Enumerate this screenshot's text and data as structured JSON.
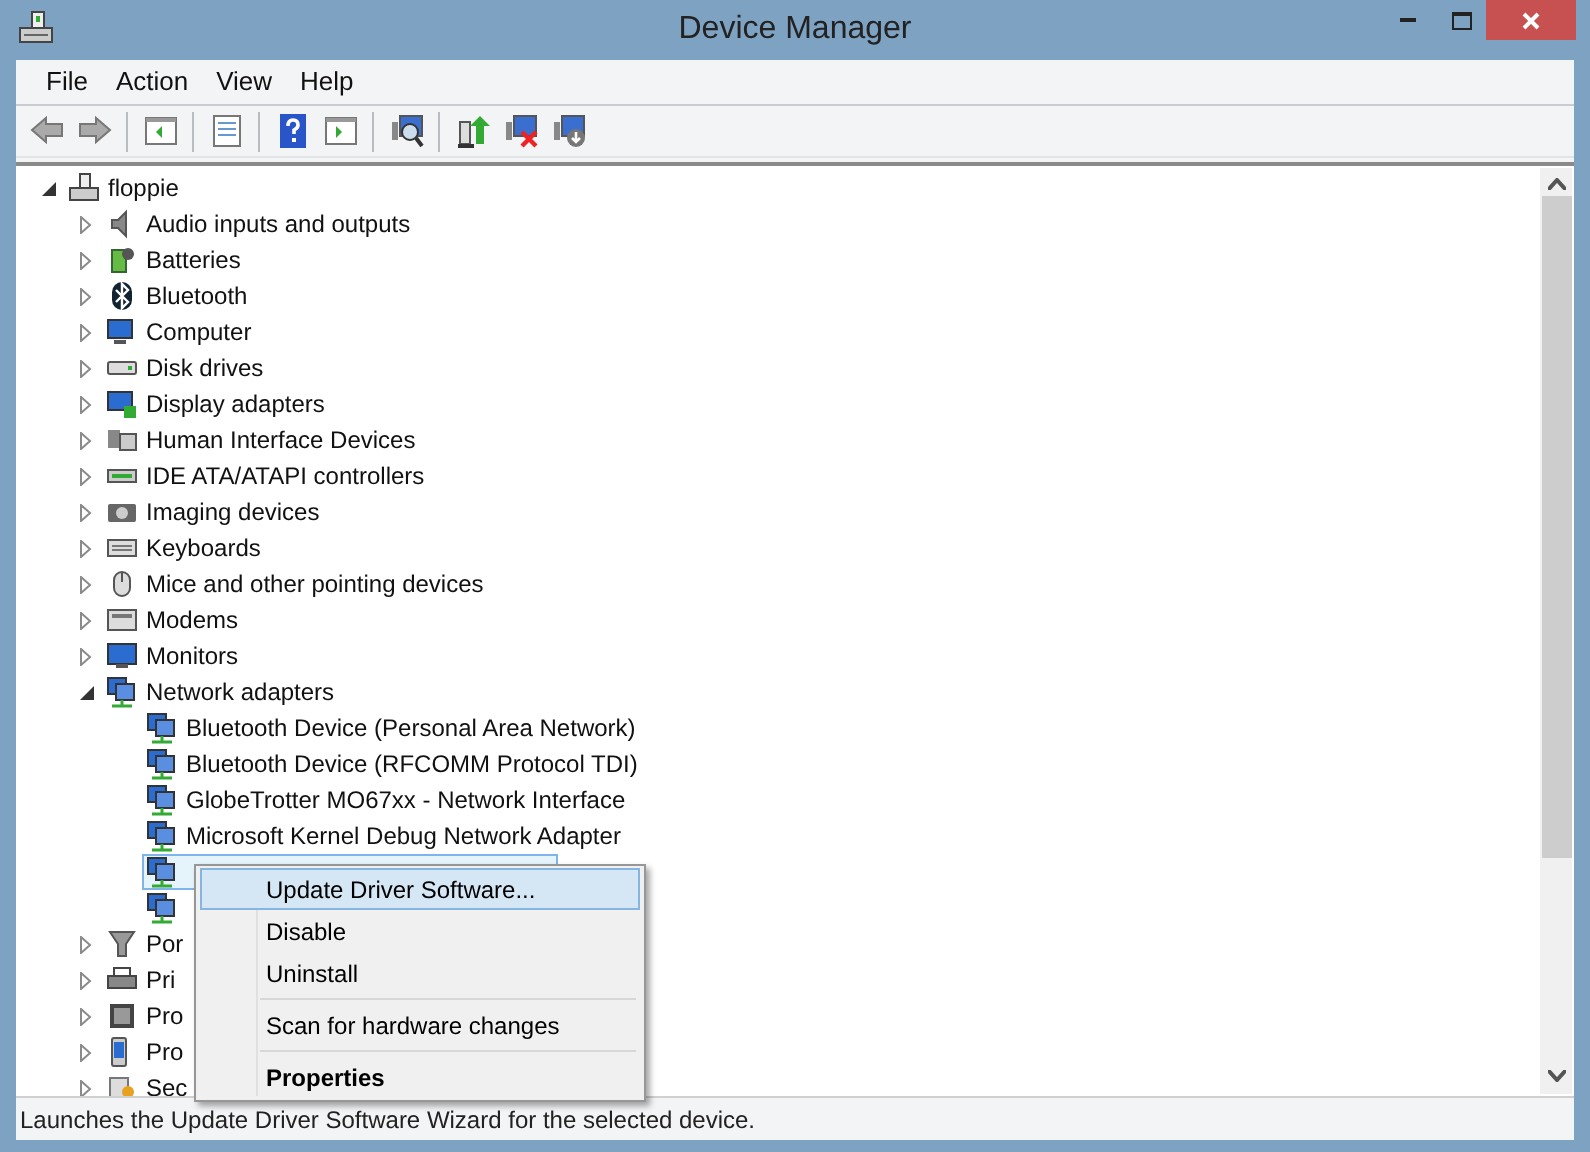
{
  "window": {
    "title": "Device Manager"
  },
  "menu_bar": [
    {
      "label": "File"
    },
    {
      "label": "Action"
    },
    {
      "label": "View"
    },
    {
      "label": "Help"
    }
  ],
  "tree": {
    "label": "floppie",
    "expanded": true,
    "children": [
      {
        "label": "Audio inputs and outputs",
        "expanded": false
      },
      {
        "label": "Batteries",
        "expanded": false
      },
      {
        "label": "Bluetooth",
        "expanded": false
      },
      {
        "label": "Computer",
        "expanded": false
      },
      {
        "label": "Disk drives",
        "expanded": false
      },
      {
        "label": "Display adapters",
        "expanded": false
      },
      {
        "label": "Human Interface Devices",
        "expanded": false
      },
      {
        "label": "IDE ATA/ATAPI controllers",
        "expanded": false
      },
      {
        "label": "Imaging devices",
        "expanded": false
      },
      {
        "label": "Keyboards",
        "expanded": false
      },
      {
        "label": "Mice and other pointing devices",
        "expanded": false
      },
      {
        "label": "Modems",
        "expanded": false
      },
      {
        "label": "Monitors",
        "expanded": false
      },
      {
        "label": "Network adapters",
        "expanded": true,
        "children": [
          {
            "label": "Bluetooth Device (Personal Area Network)",
            "selected": false
          },
          {
            "label": "Bluetooth Device (RFCOMM Protocol TDI)",
            "selected": false
          },
          {
            "label": "GlobeTrotter MO67xx - Network Interface",
            "selected": false
          },
          {
            "label": "Microsoft Kernel Debug Network Adapter",
            "selected": false
          },
          {
            "selected": true
          },
          {
            "selected": false
          }
        ]
      },
      {
        "label": "Por",
        "expanded": false
      },
      {
        "label": "Pri",
        "expanded": false
      },
      {
        "label": "Pro",
        "expanded": false
      },
      {
        "label": "Pro",
        "expanded": false
      },
      {
        "label": "Sec",
        "expanded": false
      }
    ]
  },
  "context_menu": [
    {
      "kind": "command",
      "label": "Update Driver Software...",
      "selected": true
    },
    {
      "kind": "command",
      "label": "Disable",
      "selected": false
    },
    {
      "kind": "command",
      "label": "Uninstall",
      "selected": false
    },
    {
      "kind": "separator"
    },
    {
      "kind": "command",
      "label": "Scan for hardware changes",
      "selected": false
    },
    {
      "kind": "separator"
    },
    {
      "kind": "command",
      "label": "Properties",
      "selected": false,
      "default": true
    }
  ],
  "status_bar": {
    "text": "Launches the Update Driver Software Wizard for the selected device."
  }
}
